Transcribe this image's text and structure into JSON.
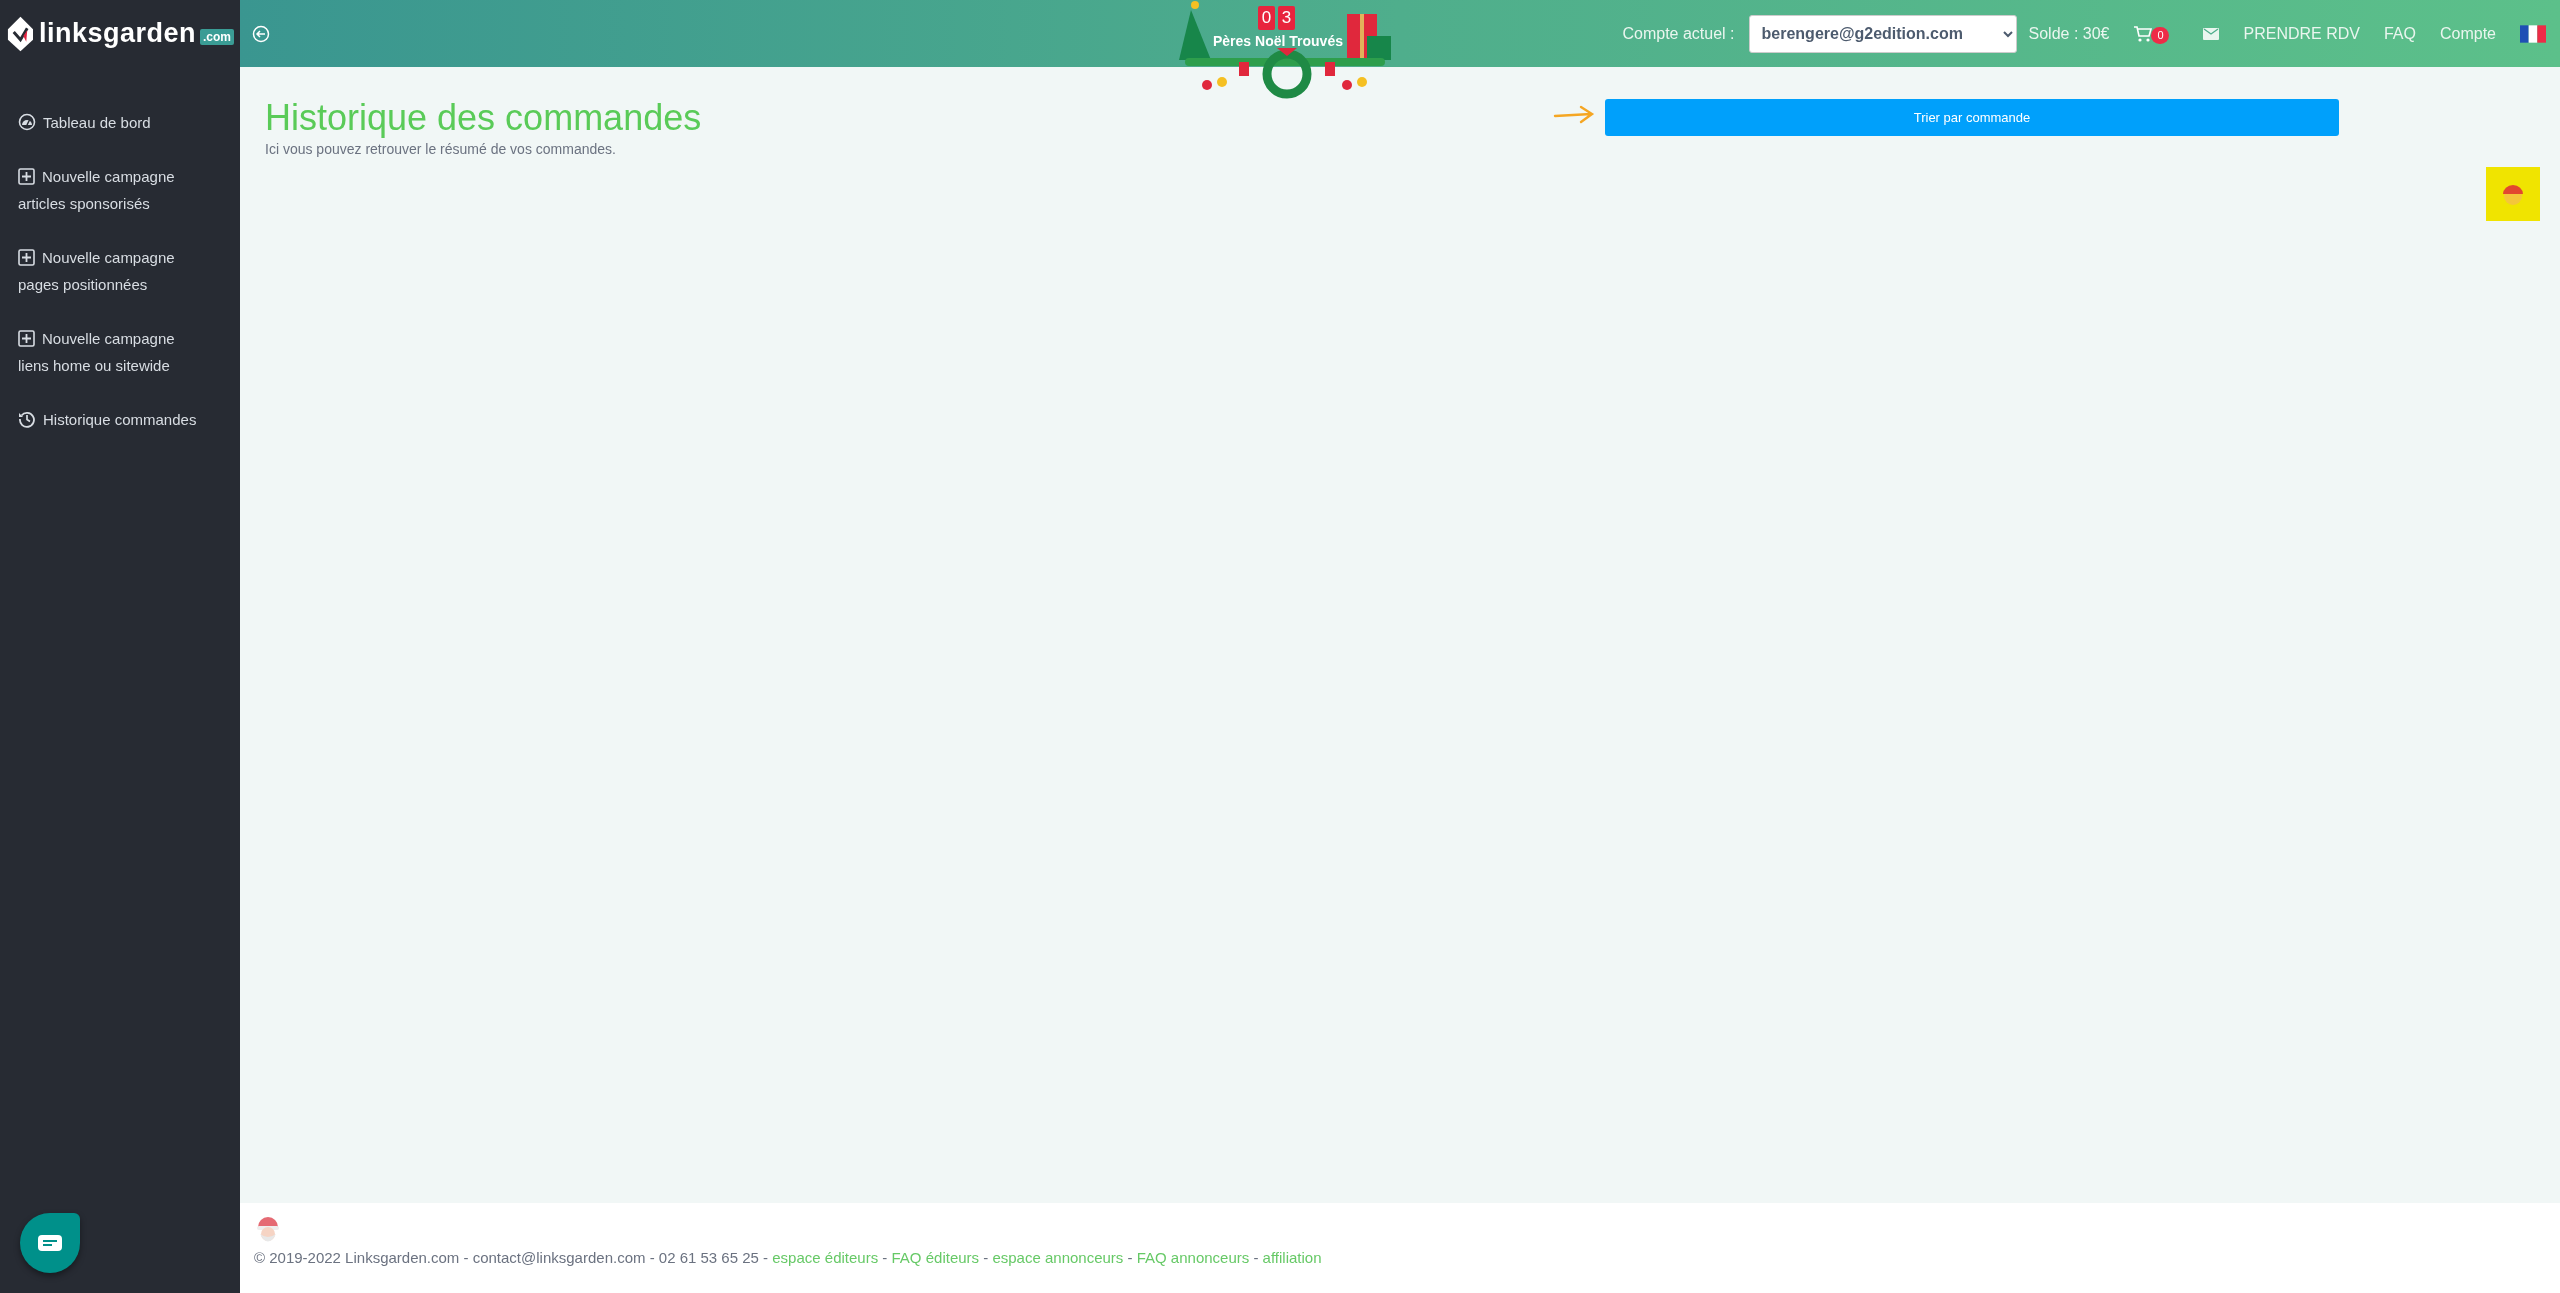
{
  "sidebar": {
    "logo": {
      "name": "linksgarden",
      "tld": ".com"
    },
    "items": [
      {
        "kind": "dashboard",
        "lines": [
          "Tableau de bord"
        ]
      },
      {
        "kind": "create",
        "lines": [
          "Nouvelle campagne",
          "articles sponsorisés"
        ]
      },
      {
        "kind": "create",
        "lines": [
          "Nouvelle campagne",
          "pages positionnées"
        ]
      },
      {
        "kind": "create",
        "lines": [
          "Nouvelle campagne",
          "liens home ou sitewide"
        ]
      },
      {
        "kind": "history",
        "lines": [
          "Historique commandes"
        ]
      }
    ]
  },
  "header": {
    "banner": {
      "digits": [
        "0",
        "3"
      ],
      "text": "Pères Noël Trouvés"
    },
    "account_label": "Compte actuel :",
    "account_select": "berengere@g2edition.com",
    "balance": "Solde : 30€",
    "cart_count": "0",
    "nav": [
      "PRENDRE RDV",
      "FAQ",
      "Compte"
    ]
  },
  "main": {
    "title": "Historique des commandes",
    "subtitle": "Ici vous pouvez retrouver le résumé de vos commandes.",
    "sort_button": "Trier par commande"
  },
  "footer": {
    "separator": "-",
    "info": [
      "© 2019-2022 Linksgarden.com",
      "contact@linksgarden.com",
      "02 61 53 65 25"
    ],
    "links": [
      "espace éditeurs",
      "FAQ éditeurs",
      "espace annonceurs",
      "FAQ annonceurs",
      "affiliation"
    ]
  }
}
